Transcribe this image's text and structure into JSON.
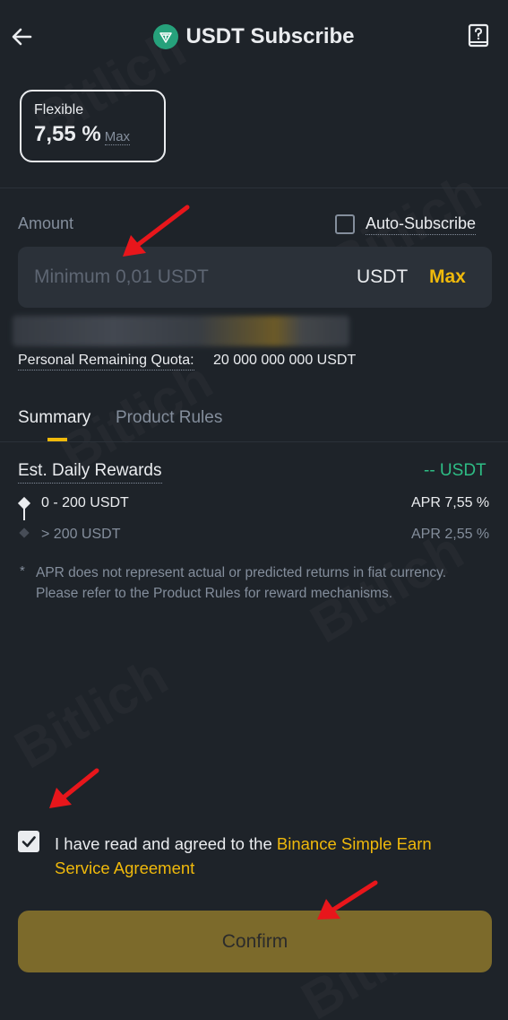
{
  "header": {
    "title": "USDT Subscribe",
    "back_icon": "arrow-left-icon",
    "help_icon": "help-book-icon",
    "coin_icon": "tether-icon"
  },
  "product": {
    "type_label": "Flexible",
    "rate": "7,55 %",
    "rate_suffix": "Max"
  },
  "amount": {
    "label": "Amount",
    "auto_subscribe_label": "Auto-Subscribe",
    "auto_subscribe_checked": false,
    "placeholder": "Minimum 0,01 USDT",
    "value": "",
    "unit": "USDT",
    "max_label": "Max"
  },
  "quota": {
    "label": "Personal Remaining Quota:",
    "value": "20 000 000 000 USDT"
  },
  "tabs": [
    {
      "label": "Summary",
      "active": true
    },
    {
      "label": "Product Rules",
      "active": false
    }
  ],
  "summary": {
    "est_daily_rewards_label": "Est. Daily Rewards",
    "est_daily_rewards_value": "-- USDT",
    "tiers": [
      {
        "range": "0 - 200 USDT",
        "apr": "APR 7,55 %"
      },
      {
        "range": "> 200 USDT",
        "apr": "APR 2,55 %"
      }
    ],
    "note_marker": "*",
    "note": "APR does not represent actual or predicted returns in fiat currency. Please refer to the Product Rules for reward mechanisms."
  },
  "agreement": {
    "checked": true,
    "text": "I have read and agreed to the ",
    "link": "Binance Simple Earn Service Agreement"
  },
  "confirm": {
    "label": "Confirm"
  },
  "watermark": "Bitlich",
  "colors": {
    "background": "#1e2329",
    "accent": "#f0b90b",
    "positive": "#2ebd85",
    "annotation_arrow": "#e8161b"
  }
}
